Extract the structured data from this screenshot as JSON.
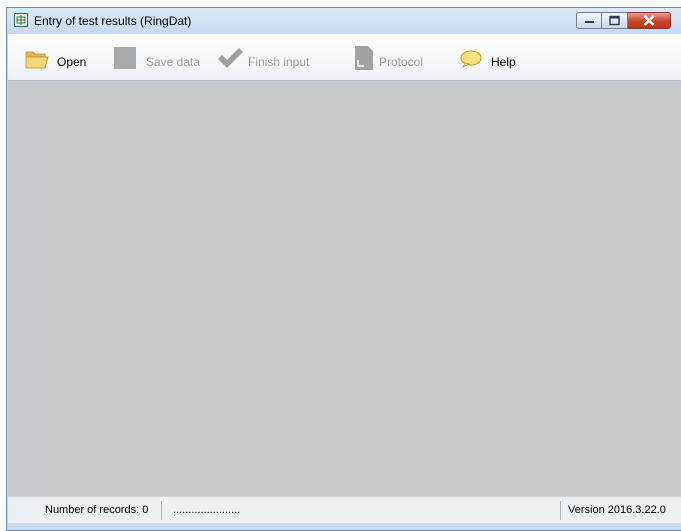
{
  "window": {
    "title": "Entry of test results (RingDat)"
  },
  "toolbar": {
    "items": [
      {
        "label": "Open",
        "icon": "folder-open-icon",
        "enabled": true
      },
      {
        "label": "Save data",
        "icon": "save-icon",
        "enabled": false
      },
      {
        "label": "Finish input",
        "icon": "checkmark-icon",
        "enabled": false
      },
      {
        "label": "Protocol",
        "icon": "document-icon",
        "enabled": false
      },
      {
        "label": "Help",
        "icon": "speech-bubble-icon",
        "enabled": true
      }
    ]
  },
  "status": {
    "records": "Number of records: 0",
    "info": "......................",
    "version": "Version 2016.3.22.0"
  },
  "colors": {
    "content_bg": "#c7c9cc",
    "close_button": "#c7442a",
    "disabled_text": "#9a9a9a"
  }
}
